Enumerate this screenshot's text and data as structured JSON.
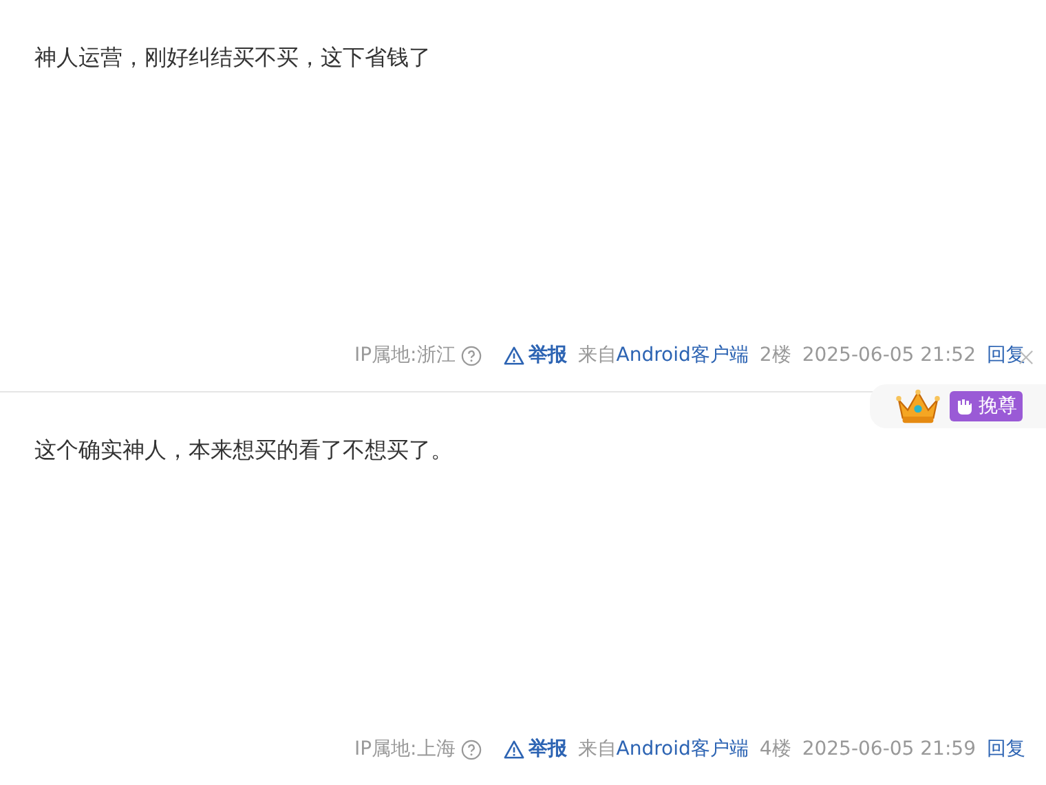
{
  "posts": [
    {
      "content": "神人运营，刚好纠结买不买，这下省钱了",
      "ip": "IP属地:浙江",
      "report": "举报",
      "source_prefix": "来自",
      "source": "Android客户端",
      "floor": "2楼",
      "time": "2025-06-05 21:52",
      "reply": "回复",
      "closable": true,
      "badge": {
        "label": "挽尊"
      }
    },
    {
      "content": "这个确实神人，本来想买的看了不想买了。",
      "ip": "IP属地:上海",
      "report": "举报",
      "source_prefix": "来自",
      "source": "Android客户端",
      "floor": "4楼",
      "time": "2025-06-05 21:59",
      "reply": "回复",
      "closable": false
    }
  ]
}
